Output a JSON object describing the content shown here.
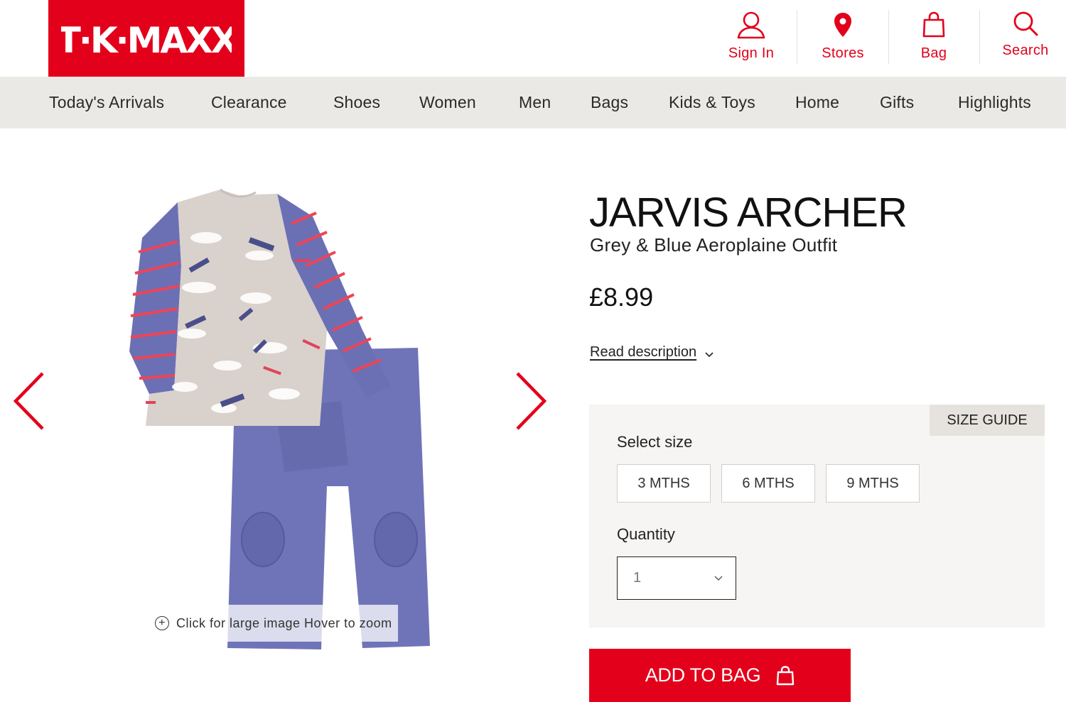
{
  "brand": {
    "logo_text": "TKMAXX",
    "accent_color": "#e3001b"
  },
  "header": {
    "utilities": [
      {
        "label": "Sign In",
        "icon": "user-icon"
      },
      {
        "label": "Stores",
        "icon": "location-pin-icon"
      },
      {
        "label": "Bag",
        "icon": "shopping-bag-icon"
      },
      {
        "label": "Search",
        "icon": "search-icon"
      }
    ]
  },
  "nav": {
    "items": [
      "Today's Arrivals",
      "Clearance",
      "Shoes",
      "Women",
      "Men",
      "Bags",
      "Kids & Toys",
      "Home",
      "Gifts",
      "Highlights"
    ]
  },
  "gallery": {
    "zoom_hint": "Click for large image Hover to zoom",
    "prev_icon": "chevron-left-icon",
    "next_icon": "chevron-right-icon"
  },
  "product": {
    "brand": "JARVIS ARCHER",
    "name": "Grey & Blue Aeroplaine Outfit",
    "price": "£8.99",
    "read_description": "Read description",
    "size_guide": "SIZE GUIDE",
    "select_size_label": "Select size",
    "sizes": [
      "3 MTHS",
      "6 MTHS",
      "9 MTHS"
    ],
    "quantity_label": "Quantity",
    "quantity_value": "1",
    "add_to_bag": "ADD TO BAG"
  }
}
